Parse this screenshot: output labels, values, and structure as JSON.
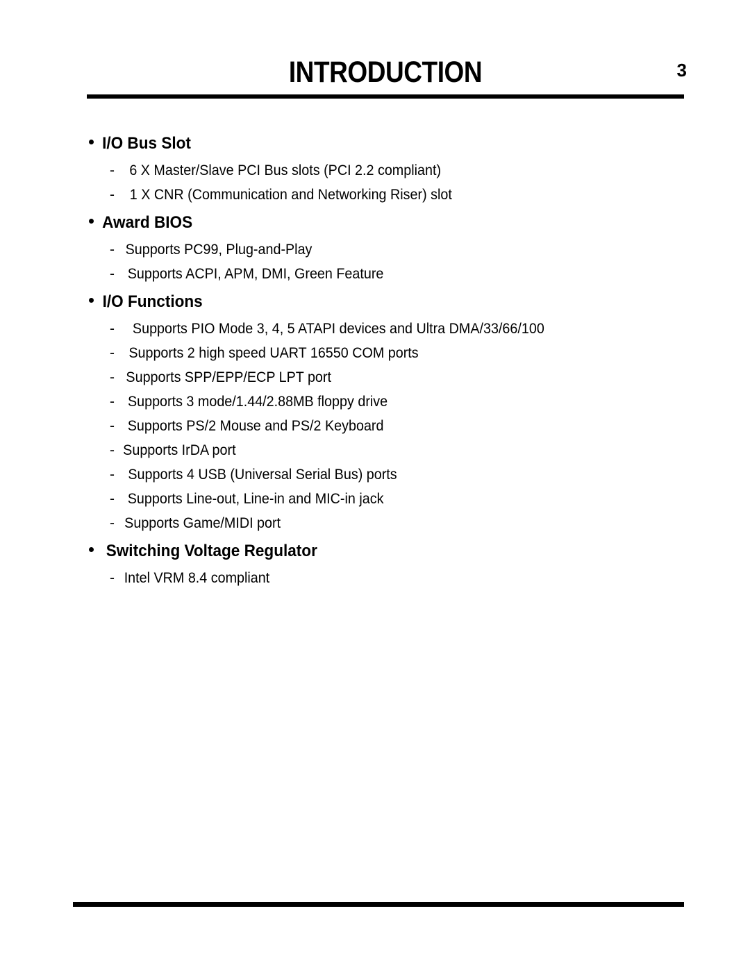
{
  "header": {
    "title": "INTRODUCTION",
    "page_number": "3"
  },
  "content": {
    "sections": [
      {
        "heading": "I/O Bus Slot",
        "items": [
          "6 X Master/Slave PCI Bus slots (PCI 2.2 compliant)",
          "1 X CNR (Communication and Networking Riser) slot"
        ]
      },
      {
        "heading": "Award  BIOS",
        "items": [
          "Supports PC99, Plug-and-Play",
          "Supports ACPI, APM, DMI, Green Feature"
        ]
      },
      {
        "heading": "I/O  Functions",
        "items": [
          "Supports PIO Mode 3, 4, 5 ATAPI devices and Ultra DMA/33/66/100",
          "Supports 2 high speed UART 16550 COM ports",
          "Supports SPP/EPP/ECP LPT port",
          "Supports 3 mode/1.44/2.88MB floppy drive",
          "Supports PS/2 Mouse and PS/2 Keyboard",
          "Supports IrDA port",
          "Supports 4 USB (Universal Serial Bus) ports",
          "Supports Line-out, Line-in and MIC-in jack",
          "Supports Game/MIDI port"
        ]
      },
      {
        "heading": "Switching  Voltage  Regulator",
        "items": [
          "Intel VRM 8.4 compliant"
        ]
      }
    ],
    "dash_marker": "-"
  }
}
